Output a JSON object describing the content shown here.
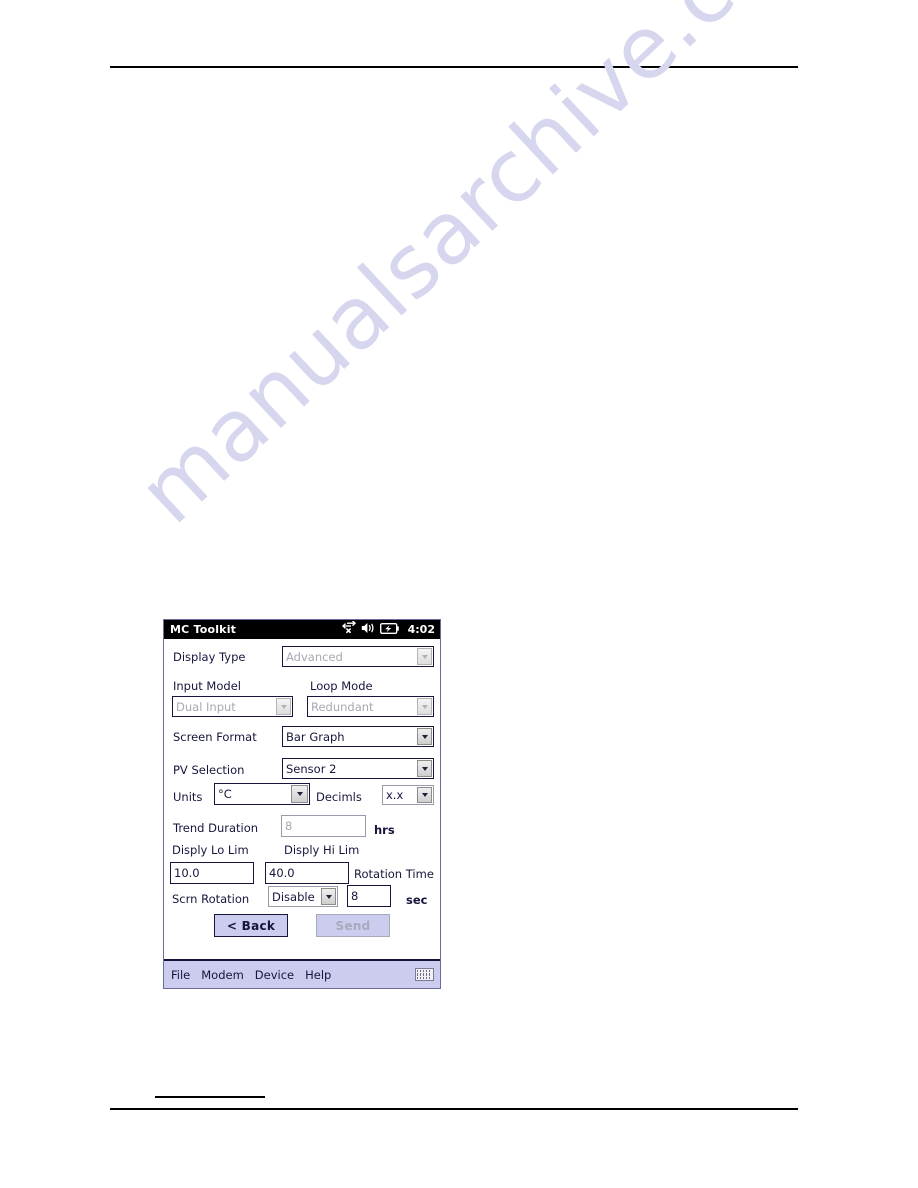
{
  "watermark": {
    "text": "manualsarchive.com"
  },
  "device": {
    "titlebar": {
      "title": "MC Toolkit",
      "clock": "4:02",
      "icons": [
        "connectivity-off-icon",
        "speaker-icon",
        "battery-icon"
      ]
    },
    "form": {
      "display_type": {
        "label": "Display Type",
        "value": "Advanced",
        "disabled": true
      },
      "input_model": {
        "label": "Input Model",
        "value": "Dual Input",
        "disabled": true
      },
      "loop_mode": {
        "label": "Loop Mode",
        "value": "Redundant",
        "disabled": true
      },
      "screen_format": {
        "label": "Screen Format",
        "value": "Bar Graph",
        "disabled": false
      },
      "pv_selection": {
        "label": "PV Selection",
        "value": "Sensor 2",
        "disabled": false
      },
      "units": {
        "label": "Units",
        "value": "°C",
        "disabled": false
      },
      "decimals": {
        "label": "Decimls",
        "value": "x.x",
        "disabled": false
      },
      "trend_duration": {
        "label": "Trend Duration",
        "value": "8",
        "unit": "hrs",
        "disabled": true
      },
      "disply_lo_lim": {
        "label": "Disply Lo Lim",
        "value": "10.0",
        "disabled": false
      },
      "disply_hi_lim": {
        "label": "Disply Hi Lim",
        "value": "40.0",
        "disabled": false
      },
      "rotation_time": {
        "label": "Rotation Time",
        "value": "8",
        "unit": "sec",
        "disabled": false
      },
      "scrn_rotation": {
        "label": "Scrn Rotation",
        "value": "Disable",
        "disabled": false
      }
    },
    "buttons": {
      "back": "< Back",
      "send": "Send"
    },
    "menubar": {
      "items": [
        "File",
        "Modem",
        "Device",
        "Help"
      ],
      "sip": "keyboard-icon"
    }
  },
  "colors": {
    "titlebar_bg": "#000000",
    "menubar_bg": "#ccccee",
    "button_bg": "#ccccee",
    "text": "#16163c",
    "disabled_text": "#a8a8b4",
    "watermark": "#d6d6ef"
  }
}
